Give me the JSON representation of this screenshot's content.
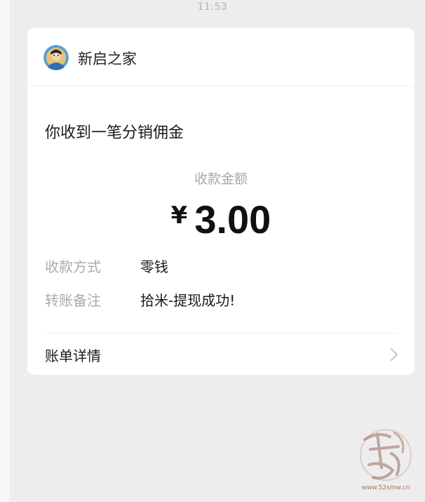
{
  "status_bar": {
    "time": "11:53"
  },
  "card": {
    "account_name": "新启之家",
    "title": "你收到一笔分销佣金",
    "amount_label": "收款金额",
    "currency_symbol": "¥",
    "amount": "3.00",
    "details": [
      {
        "label": "收款方式",
        "value": "零钱"
      },
      {
        "label": "转账备注",
        "value": "拾米-提现成功!"
      }
    ],
    "bill_link_label": "账单详情"
  },
  "icons": {
    "avatar": "account-avatar",
    "chevron": "chevron-right-icon"
  },
  "watermark": {
    "url": "www.52smw.cn"
  },
  "colors": {
    "background": "#ededed",
    "card": "#ffffff",
    "muted_text": "#aaaaaa",
    "primary_text": "#1a1a1a"
  }
}
